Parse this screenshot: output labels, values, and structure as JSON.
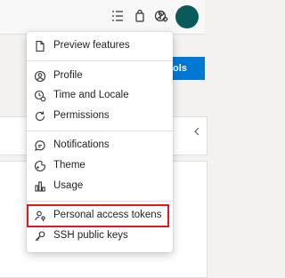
{
  "topbar": {
    "icons": [
      "task-list-icon",
      "shopping-bag-icon",
      "help-icon",
      "user-settings-icon",
      "avatar"
    ],
    "avatar_color": "#0a5a5a"
  },
  "background": {
    "button_label": "ols",
    "accent": "#0078d4"
  },
  "menu": {
    "items": [
      {
        "label": "Preview features",
        "icon": "document-icon"
      },
      {
        "label": "Profile",
        "icon": "profile-icon"
      },
      {
        "label": "Time and Locale",
        "icon": "time-locale-icon"
      },
      {
        "label": "Permissions",
        "icon": "refresh-icon"
      },
      {
        "label": "Notifications",
        "icon": "chat-bubble-icon"
      },
      {
        "label": "Theme",
        "icon": "theme-icon"
      },
      {
        "label": "Usage",
        "icon": "bar-chart-icon"
      },
      {
        "label": "Personal access tokens",
        "icon": "person-key-icon"
      },
      {
        "label": "SSH public keys",
        "icon": "key-icon"
      }
    ],
    "highlighted_item": "Personal access tokens",
    "highlight_color": "#e31919"
  }
}
